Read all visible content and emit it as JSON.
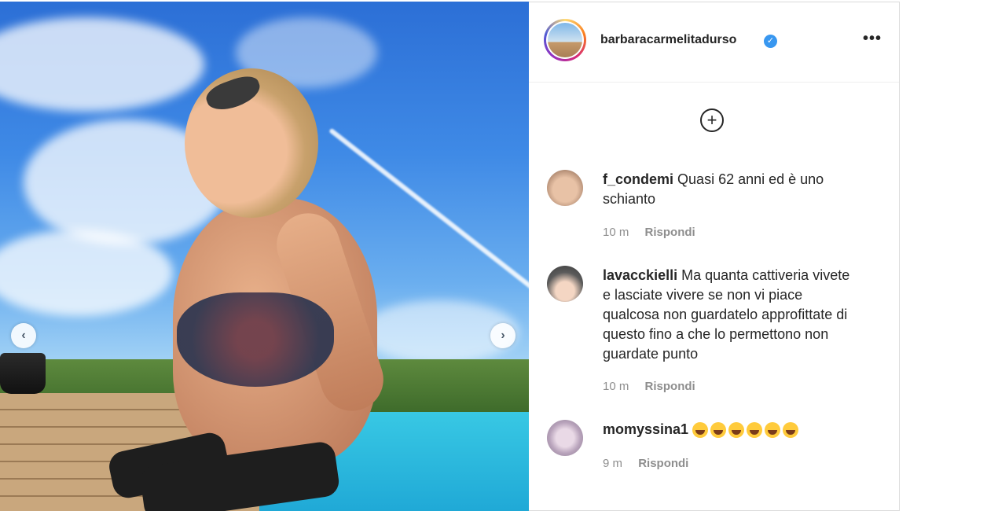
{
  "post": {
    "username": "barbaracarmelitadurso",
    "verified_icon": "verified-badge-icon",
    "more_icon": "more-options-icon",
    "more_label": "•••",
    "add_icon": "plus-circle-icon",
    "add_label": "+",
    "nav_prev": "‹",
    "nav_next": "›"
  },
  "comments": [
    {
      "user": "f_condemi",
      "text": "Quasi 62 anni ed è uno schianto",
      "time": "10 m",
      "reply": "Rispondi"
    },
    {
      "user": "lavacckielli",
      "text": "Ma quanta cattiveria vivete e lasciate vivere se non vi piace qualcosa non guardatelo approfittate di questo fino a che lo permettono non guardate punto",
      "time": "10 m",
      "reply": "Rispondi"
    },
    {
      "user": "momyssina1",
      "text": "",
      "emoji_count": 6,
      "emoji_icon": "laughing-tears-emoji",
      "time": "9 m",
      "reply": "Rispondi"
    }
  ],
  "colors": {
    "accent": "#3897f0",
    "text": "#262626",
    "meta": "#8e8e8e"
  }
}
